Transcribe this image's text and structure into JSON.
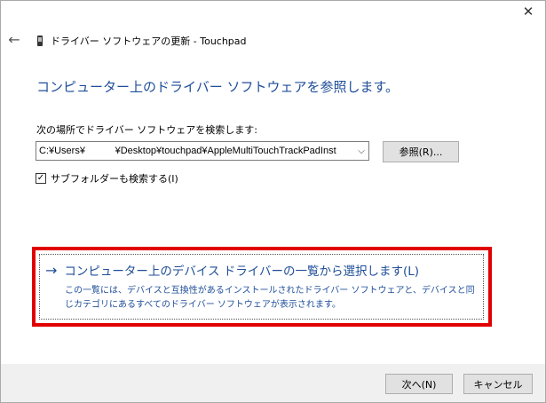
{
  "window": {
    "close_glyph": "✕",
    "back_glyph": "←",
    "title": "ドライバー ソフトウェアの更新 - Touchpad"
  },
  "main": {
    "heading": "コンピューター上のドライバー ソフトウェアを参照します。",
    "search_label": "次の場所でドライバー ソフトウェアを検索します:",
    "path_value": "C:¥Users¥           ¥Desktop¥touchpad¥AppleMultiTouchTrackPadInst",
    "browse_label": "参照(R)...",
    "include_subfolders_label": "サブフォルダーも検索する(I)",
    "include_subfolders_checked": true
  },
  "option": {
    "arrow_glyph": "→",
    "title": "コンピューター上のデバイス ドライバーの一覧から選択します(L)",
    "description": "この一覧には、デバイスと互換性があるインストールされたドライバー ソフトウェアと、デバイスと同じカテゴリにあるすべてのドライバー ソフトウェアが表示されます。"
  },
  "footer": {
    "next_label": "次へ(N)",
    "cancel_label": "キャンセル"
  },
  "colors": {
    "accent_text": "#1f4e99",
    "highlight_red": "#e10000",
    "footer_bg": "#f0f0f0"
  },
  "icons": {
    "device": "touchpad-device-icon",
    "dropdown": "chevron-down-icon",
    "checkmark": "checkmark-icon"
  }
}
